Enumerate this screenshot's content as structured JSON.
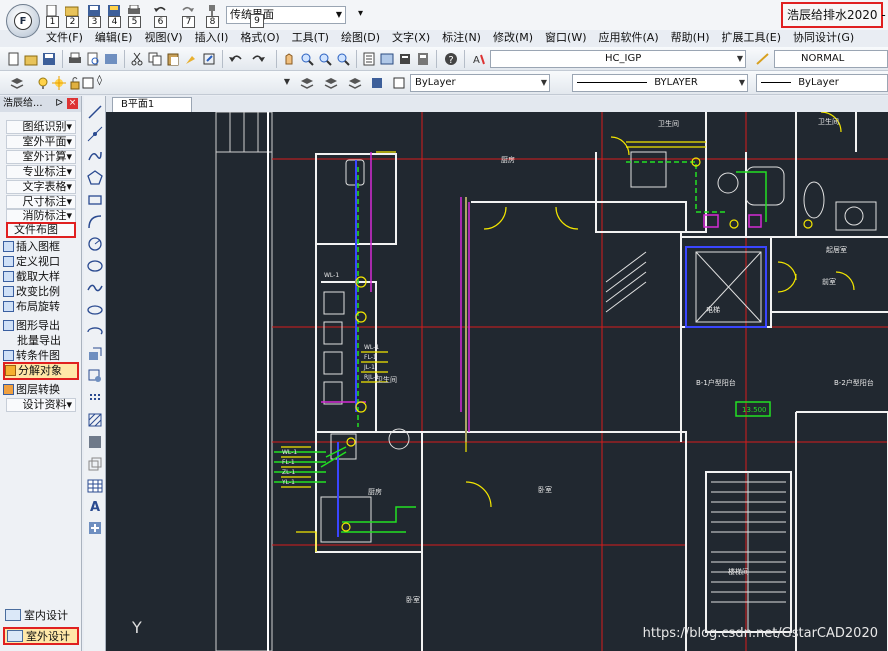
{
  "window": {
    "app_button_letter": "F",
    "title": "浩辰给排水2020 -",
    "workspace": "传统界面",
    "quick_access_numbers": [
      "1",
      "2",
      "3",
      "4",
      "5",
      "6",
      "7",
      "8"
    ],
    "workspace_number": "9"
  },
  "menubar": [
    "文件(F)",
    "编辑(E)",
    "视图(V)",
    "插入(I)",
    "格式(O)",
    "工具(T)",
    "绘图(D)",
    "文字(X)",
    "标注(N)",
    "修改(M)",
    "窗口(W)",
    "应用软件(A)",
    "帮助(H)",
    "扩展工具(E)",
    "协同设计(G)"
  ],
  "toolbar": {
    "textstyle": "HC_IGP",
    "dimstyle": "NORMAL",
    "layer_color": "ByLayer",
    "linetype": "BYLAYER",
    "lineweight": "ByLayer"
  },
  "palette": {
    "title": "浩辰给...",
    "pin": "ᐅ",
    "close": "×",
    "categories": [
      "图纸识别",
      "室外平面",
      "室外计算",
      "专业标注",
      "文字表格",
      "尺寸标注",
      "消防标注"
    ],
    "highlighted_category": "文件布图",
    "commands": [
      "插入图框",
      "定义视口",
      "截取大样",
      "改变比例",
      "布局旋转",
      "图形导出",
      "批量导出",
      "转条件图"
    ],
    "highlighted_command": "分解对象",
    "commands2": [
      "图层转换"
    ],
    "design_data": "设计资料",
    "bottom": [
      "室内设计",
      "室外设计"
    ]
  },
  "document": {
    "tab": "B平面1"
  },
  "canvas": {
    "ucs_label": "Y",
    "watermark": "https://blog.csdn.net/GstarCAD2020",
    "room_labels": [
      "卫生间",
      "卫生间",
      "卫生间",
      "厨房",
      "厨房",
      "卧室",
      "卧室",
      "起居室",
      "B-1户型阳台",
      "B-2户型阳台",
      "电梯",
      "楼梯间",
      "前室"
    ],
    "level_label": "13.500",
    "pipe_labels": [
      "WL-1",
      "FL-1",
      "JL-1",
      "RJL-1",
      "ZL-1",
      "YL-1"
    ],
    "colors": {
      "background": "#212830",
      "wall": "#ffffff",
      "red_axis": "#d81b1b",
      "yellow": "#f3e600",
      "green_pipe": "#22e022",
      "magenta": "#d52bd5",
      "blue_pipe": "#3a46ff",
      "cyan": "#22d8d8"
    }
  }
}
